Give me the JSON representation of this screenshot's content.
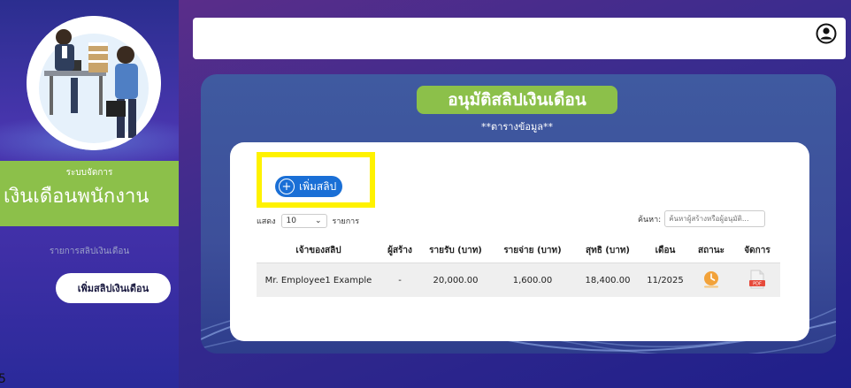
{
  "sidebar": {
    "brand_top": "ระบบจัดการ",
    "brand_main": "เงินเดือนพนักงาน",
    "nav_title": "รายการสลิปเงินเดือน",
    "nav_button": "เพิ่มสลิปเงินเดือน",
    "footer_fragment": "5"
  },
  "panel": {
    "title": "อนุมัติสลิปเงินเดือน",
    "subtitle": "**ตารางข้อมูล**",
    "add_button": "เพิ่มสลิป",
    "show_label": "แสดง",
    "show_value": "10",
    "show_suffix": "รายการ",
    "search_label": "ค้นหา:",
    "search_placeholder": "ค้นหาผู้สร้างหรือผู้อนุมัติ..."
  },
  "table": {
    "headers": [
      "เจ้าของสลิป",
      "ผู้สร้าง",
      "รายรับ (บาท)",
      "รายจ่าย (บาท)",
      "สุทธิ (บาท)",
      "เดือน",
      "สถานะ",
      "จัดการ"
    ],
    "rows": [
      {
        "owner": "Mr. Employee1 Example",
        "creator": "-",
        "income": "20,000.00",
        "expense": "1,600.00",
        "net": "18,400.00",
        "month": "11/2025"
      }
    ]
  },
  "colors": {
    "green": "#8cc04a",
    "blue": "#1a6fd6",
    "highlight": "#fff200"
  },
  "icons": [
    "user-circle-icon",
    "plus-icon",
    "chevron-down-icon",
    "clock-status-icon",
    "pdf-icon"
  ]
}
